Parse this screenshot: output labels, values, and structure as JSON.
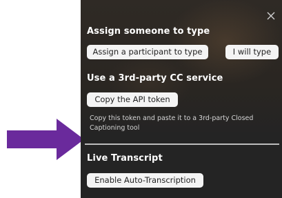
{
  "assign": {
    "heading": "Assign someone to type",
    "participant_button": "Assign a participant to type",
    "self_button": "I will type"
  },
  "third_party": {
    "heading": "Use a 3rd-party CC service",
    "copy_button": "Copy the API token",
    "description": "Copy this token and paste it to a 3rd-party Closed Captioning tool"
  },
  "live_transcript": {
    "heading": "Live Transcript",
    "enable_button": "Enable Auto-Transcription"
  },
  "colors": {
    "panel": "#242424",
    "arrow": "#6a2a9c",
    "button": "#f4f4f4"
  },
  "icons": {
    "close": "close-icon",
    "arrow": "arrow-right-icon"
  }
}
